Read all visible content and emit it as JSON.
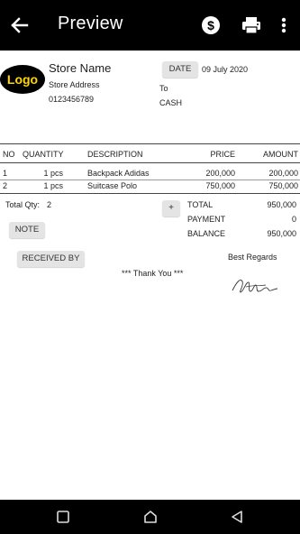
{
  "appbar": {
    "title": "Preview"
  },
  "store": {
    "logo_text": "Logo",
    "name": "Store Name",
    "address": "Store Address",
    "phone": "0123456789"
  },
  "meta": {
    "date_button": "DATE",
    "date_value": "09 July 2020",
    "to_label": "To",
    "customer": "CASH"
  },
  "table": {
    "headers": [
      "NO",
      "QUANTITY",
      "DESCRIPTION",
      "PRICE",
      "AMOUNT"
    ],
    "rows": [
      [
        "1",
        "1 pcs",
        "Backpack Adidas",
        "200,000",
        "200,000"
      ],
      [
        "2",
        "1 pcs",
        "Suitcase Polo",
        "750,000",
        "750,000"
      ]
    ]
  },
  "summary": {
    "total_qty_label": "Total Qty:",
    "total_qty_value": "2",
    "plus_button": "+",
    "total_label": "TOTAL",
    "total_value": "950,000",
    "payment_label": "PAYMENT",
    "payment_value": "0",
    "balance_label": "BALANCE",
    "balance_value": "950,000"
  },
  "footer": {
    "note_button": "NOTE",
    "received_by_button": "RECEIVED BY",
    "best_regards": "Best Regards",
    "thank_you": "*** Thank You ***"
  },
  "icons": {
    "back": "arrow-left-icon",
    "currency": "dollar-circle-icon",
    "print": "printer-icon",
    "more": "more-vertical-icon",
    "signature": "signature-image",
    "nav_recents": "square-icon",
    "nav_home": "home-icon",
    "nav_back": "triangle-back-icon"
  }
}
